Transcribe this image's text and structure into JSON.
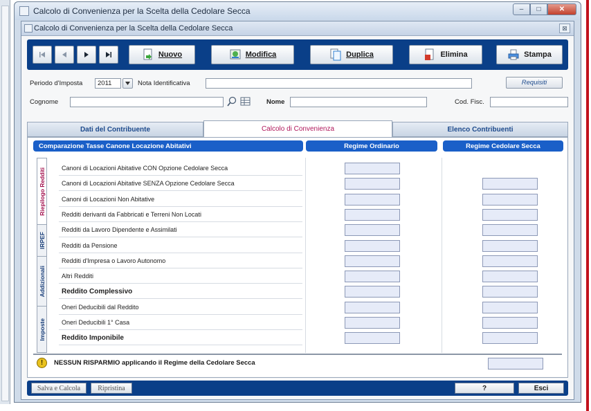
{
  "window": {
    "title": "Calcolo di Convenienza per la Scelta della Cedolare Secca",
    "inner_title": "Calcolo di Convenienza per la Scelta della Cedolare Secca",
    "minimize_glyph": "–",
    "maximize_glyph": "□",
    "close_glyph": "✕",
    "inner_close_glyph": "⊠"
  },
  "toolbar": {
    "nav_buttons": [
      "first-record",
      "previous-record",
      "next-record",
      "last-record"
    ],
    "buttons": [
      {
        "label": "Nuovo",
        "icon": "new-document-icon"
      },
      {
        "label": "Modifica",
        "icon": "edit-icon"
      },
      {
        "label": "Duplica",
        "icon": "duplicate-icon"
      },
      {
        "label": "Elimina",
        "icon": "delete-icon"
      },
      {
        "label": "Stampa",
        "icon": "print-icon"
      }
    ]
  },
  "form": {
    "periodo_label": "Periodo d'Imposta",
    "periodo_value": "2011",
    "nota_label": "Nota Identificativa",
    "nota_value": "",
    "requisiti_label": "Requisiti",
    "cognome_label": "Cognome",
    "cognome_value": "",
    "nome_label": "Nome",
    "nome_value": "",
    "codfisc_label": "Cod. Fisc.",
    "codfisc_value": ""
  },
  "tabs": [
    {
      "label": "Dati del Contribuente",
      "active": false
    },
    {
      "label": "Calcolo di Convenienza",
      "active": true
    },
    {
      "label": "Elenco Contribuenti",
      "active": false
    }
  ],
  "table": {
    "headers": [
      "Comparazione Tasse Canone Locazione Abitativi",
      "Regime Ordinario",
      "Regime Cedolare Secca"
    ],
    "side_tabs": [
      "Riepilogo Redditi",
      "IRPEF",
      "Addizionali",
      "Imposte"
    ],
    "rows": [
      {
        "label": "Canoni di Locazioni Abitative CON Opzione Cedolare Secca",
        "bold": false,
        "ordinario": "",
        "cedolare": null
      },
      {
        "label": "Canoni di Locazioni Abitative SENZA Opzione Cedolare Secca",
        "bold": false,
        "ordinario": "",
        "cedolare": ""
      },
      {
        "label": "Canoni di Locazioni Non Abitative",
        "bold": false,
        "ordinario": "",
        "cedolare": ""
      },
      {
        "label": "Redditi derivanti da Fabbricati e Terreni Non Locati",
        "bold": false,
        "ordinario": "",
        "cedolare": ""
      },
      {
        "label": "Redditi da Lavoro Dipendente e Assimilati",
        "bold": false,
        "ordinario": "",
        "cedolare": ""
      },
      {
        "label": "Redditi da Pensione",
        "bold": false,
        "ordinario": "",
        "cedolare": ""
      },
      {
        "label": "Redditi d'Impresa o Lavoro Autonomo",
        "bold": false,
        "ordinario": "",
        "cedolare": ""
      },
      {
        "label": "Altri Redditi",
        "bold": false,
        "ordinario": "",
        "cedolare": ""
      },
      {
        "label": "Reddito Complessivo",
        "bold": true,
        "ordinario": "",
        "cedolare": ""
      },
      {
        "label": "Oneri Deducibili dal Reddito",
        "bold": false,
        "ordinario": "",
        "cedolare": ""
      },
      {
        "label": "Oneri Deducibili 1° Casa",
        "bold": false,
        "ordinario": "",
        "cedolare": ""
      },
      {
        "label": "Reddito Imponibile",
        "bold": true,
        "ordinario": "",
        "cedolare": ""
      }
    ],
    "saving_text": "NESSUN RISPARMIO applicando il Regime della Cedolare Secca",
    "saving_value": ""
  },
  "bottom": {
    "salva": "Salva e Calcola",
    "ripristina": "Ripristina",
    "help": "?",
    "esci": "Esci"
  },
  "colors": {
    "toolbar_blue": "#0a3f88",
    "header_blue": "#1a5fc8",
    "active_tab_text": "#b0175b",
    "input_fill": "#e6ebf8",
    "accent_red": "#c1121c"
  }
}
